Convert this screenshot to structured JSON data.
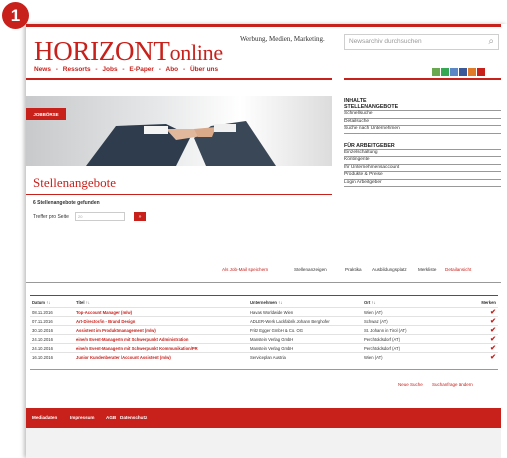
{
  "badge": "1",
  "logo": {
    "main": "HORIZONT",
    "suffix": "online"
  },
  "tagline": "Werbung, Medien, Marketing.",
  "search": {
    "placeholder": "Newsarchiv durchsuchen"
  },
  "nav": [
    "News",
    "-",
    "Ressorts",
    "-",
    "Jobs",
    "-",
    "E-Paper",
    "-",
    "Abo",
    "-",
    "Über uns"
  ],
  "social_colors": [
    "#6aa84f",
    "#34a853",
    "#5b87c7",
    "#3b5998",
    "#e07b2a",
    "#c8211b"
  ],
  "hero": {
    "tag": "JOBBÖRSE"
  },
  "page_title": "Stellenangebote",
  "results_found": "6 Stellenangebote gefunden",
  "per_page": {
    "label": "Treffer pro Seite",
    "value": "20",
    "button": "»"
  },
  "sidebar": {
    "section1_title": "INHALTE",
    "section1_subtitle": "STELLENANGEBOTE",
    "section1_items": [
      "Schnellsuche",
      "Detailsuche",
      "Suche nach Unternehmen"
    ],
    "section2_title": "FÜR ARBEITGEBER",
    "section2_items": [
      "Einzelschaltung",
      "Kontingente",
      "Ihr Unternehmensaccount",
      "Produkte & Preise",
      "Login Arbeitgeber"
    ]
  },
  "tabs": {
    "alert": "Als Job-Mail speichern",
    "items": [
      "Stellenanzeigen",
      "Praktika",
      "Ausbildungsplatz",
      "Merkliste"
    ],
    "detail": "Detailansicht"
  },
  "table": {
    "headers": [
      "Datum ↑↓",
      "Titel ↑↓",
      "Unternehmen ↑↓",
      "Ort ↑↓",
      "Merken"
    ],
    "rows": [
      {
        "date": "08.11.2016",
        "title": "Top-Account Manager (m/w)",
        "company": "Havas Worldwide Wien",
        "place": "Wien (AT)",
        "mark": "✔"
      },
      {
        "date": "07.11.2016",
        "title": "Art-Director/in - Brand Design",
        "company": "ADLER-Werk Lackfabrik Johann Berghofer",
        "place": "Schwaz (AT)",
        "mark": "✔"
      },
      {
        "date": "30.10.2016",
        "title": "Assistent im Produktmanagement (m/w)",
        "company": "Fritz Egger GmbH & Co. OG",
        "place": "St. Johann in Tirol (AT)",
        "mark": "✔"
      },
      {
        "date": "24.10.2016",
        "title": "eine/n Event-ManagerIn mit Schwerpunkt Administration",
        "company": "Manstein Verlag GmbH",
        "place": "Perchtoldsdorf (AT)",
        "mark": "✔"
      },
      {
        "date": "24.10.2016",
        "title": "eine/n Event-ManagerIn mit Schwerpunkt Kommunikation/PR",
        "company": "Manstein Verlag GmbH",
        "place": "Perchtoldsdorf (AT)",
        "mark": "✔"
      },
      {
        "date": "16.10.2016",
        "title": "Junior Kundenberater /Account Assistent (m/w)",
        "company": "Serviceplan Austria",
        "place": "Wien (AT)",
        "mark": "✔"
      }
    ]
  },
  "bottom_links": [
    "Neue Suche",
    "Suchanfrage ändern"
  ],
  "footer": [
    "Mediadaten",
    "Impressum",
    "AGB",
    "Datenschutz"
  ]
}
